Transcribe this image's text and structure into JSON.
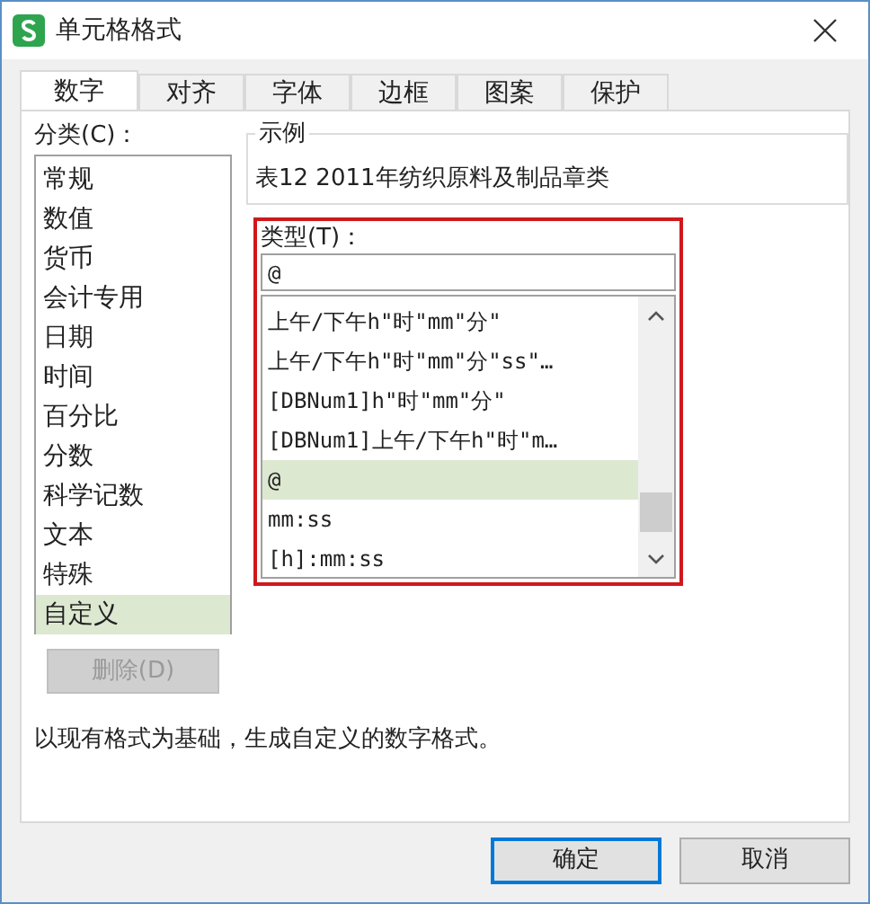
{
  "window": {
    "title": "单元格格式"
  },
  "tabs": [
    {
      "label": "数字",
      "selected": true
    },
    {
      "label": "对齐",
      "selected": false
    },
    {
      "label": "字体",
      "selected": false
    },
    {
      "label": "边框",
      "selected": false
    },
    {
      "label": "图案",
      "selected": false
    },
    {
      "label": "保护",
      "selected": false
    }
  ],
  "category": {
    "label": "分类(C)：",
    "items": [
      {
        "label": "常规",
        "selected": false
      },
      {
        "label": "数值",
        "selected": false
      },
      {
        "label": "货币",
        "selected": false
      },
      {
        "label": "会计专用",
        "selected": false
      },
      {
        "label": "日期",
        "selected": false
      },
      {
        "label": "时间",
        "selected": false
      },
      {
        "label": "百分比",
        "selected": false
      },
      {
        "label": "分数",
        "selected": false
      },
      {
        "label": "科学记数",
        "selected": false
      },
      {
        "label": "文本",
        "selected": false
      },
      {
        "label": "特殊",
        "selected": false
      },
      {
        "label": "自定义",
        "selected": true
      }
    ]
  },
  "delete_button": {
    "label": "删除(D)",
    "disabled": true
  },
  "sample": {
    "legend": "示例",
    "value": "表12 2011年纺织原料及制品章类"
  },
  "type": {
    "label": "类型(T)：",
    "value": "@",
    "items": [
      {
        "label": "上午/下午h\"时\"mm\"分\"",
        "selected": false
      },
      {
        "label": "上午/下午h\"时\"mm\"分\"ss\"…",
        "selected": false
      },
      {
        "label": "[DBNum1]h\"时\"mm\"分\"",
        "selected": false
      },
      {
        "label": "[DBNum1]上午/下午h\"时\"m…",
        "selected": false
      },
      {
        "label": "@",
        "selected": true
      },
      {
        "label": "mm:ss",
        "selected": false
      },
      {
        "label": "[h]:mm:ss",
        "selected": false
      }
    ]
  },
  "description": "以现有格式为基础，生成自定义的数字格式。",
  "buttons": [
    {
      "label": "确定",
      "default": true
    },
    {
      "label": "取消",
      "default": false
    }
  ]
}
